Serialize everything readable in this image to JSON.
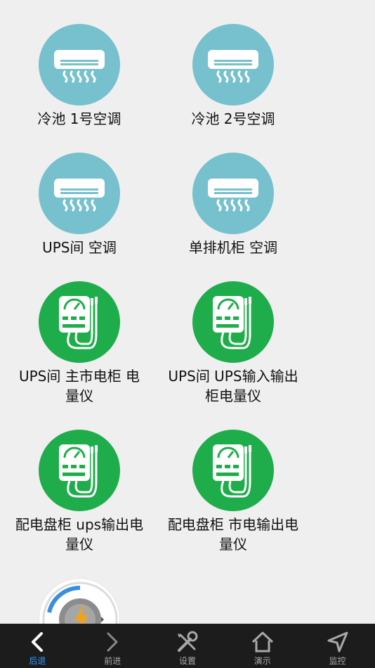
{
  "devices": [
    {
      "label": "冷池 1号空调",
      "icon": "air-conditioner-icon"
    },
    {
      "label": "冷池 2号空调",
      "icon": "air-conditioner-icon"
    },
    {
      "label": "UPS间 空调",
      "icon": "air-conditioner-icon"
    },
    {
      "label": "单排机柜 空调",
      "icon": "air-conditioner-icon"
    },
    {
      "label": "UPS间 主市电柜 电量仪",
      "icon": "power-meter-icon"
    },
    {
      "label": "UPS间 UPS输入输出柜电量仪",
      "icon": "power-meter-icon"
    },
    {
      "label": "配电盘柜 ups输出电量仪",
      "icon": "power-meter-icon"
    },
    {
      "label": "配电盘柜 市电输出电量仪",
      "icon": "power-meter-icon"
    },
    {
      "label": "",
      "icon": "energy-gauge-icon"
    }
  ],
  "tabbar": {
    "items": [
      {
        "label": "后退",
        "icon": "chevron-left-icon"
      },
      {
        "label": "前进",
        "icon": "chevron-right-icon"
      },
      {
        "label": "设置",
        "icon": "tools-icon"
      },
      {
        "label": "演示",
        "icon": "home-icon"
      },
      {
        "label": "监控",
        "icon": "navigation-arrow-icon"
      }
    ],
    "active_index": 0
  },
  "colors": {
    "ac_circle": "#76c1cd",
    "meter_circle": "#1fac4b",
    "tabbar_bg": "#1c1c1d",
    "tab_active": "#2e9bff",
    "tab_inactive": "#a8a8a8",
    "background": "#efefef"
  }
}
